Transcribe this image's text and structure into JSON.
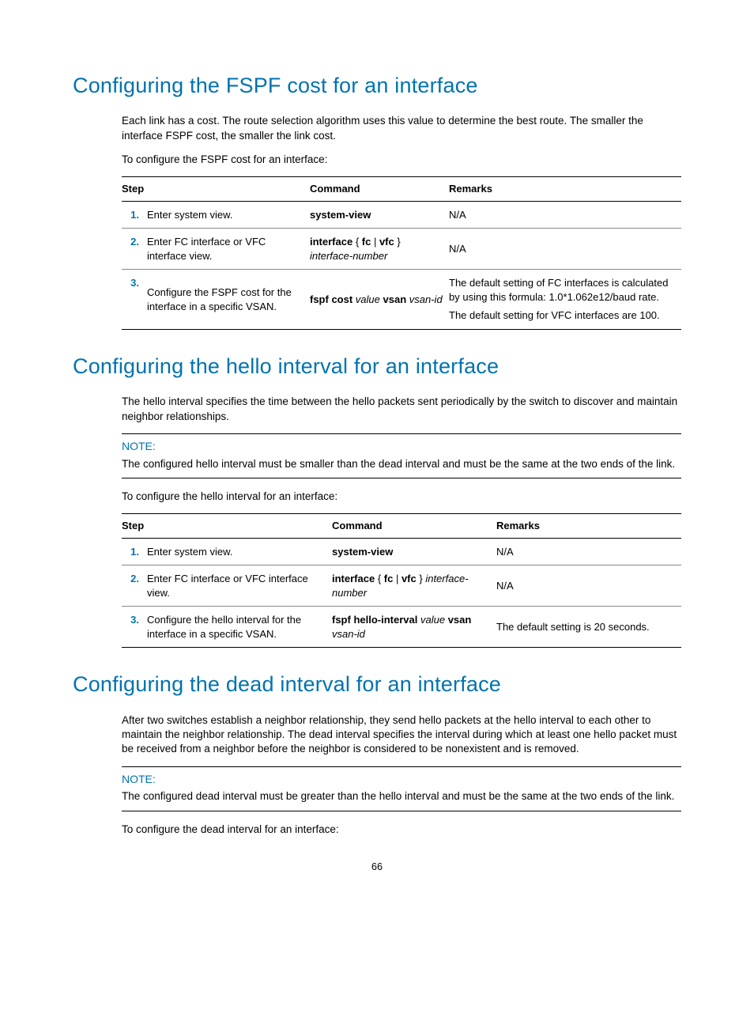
{
  "section1": {
    "heading": "Configuring the FSPF cost for an interface",
    "para1": "Each link has a cost. The route selection algorithm uses this value to determine the best route. The smaller the interface FSPF cost, the smaller the link cost.",
    "para2": "To configure the FSPF cost for an interface:",
    "table": {
      "headers": {
        "step": "Step",
        "command": "Command",
        "remarks": "Remarks"
      },
      "rows": [
        {
          "num": "1.",
          "step": "Enter system view.",
          "cmd_html": "<b>system-view</b>",
          "remarks_html": "N/A"
        },
        {
          "num": "2.",
          "step": "Enter FC interface or VFC interface view.",
          "cmd_html": "<b>interface</b> { <b>fc</b> | <b>vfc</b> } <i>interface-number</i>",
          "remarks_html": "N/A"
        },
        {
          "num": "3.",
          "step": "Configure the FSPF cost for the interface in a specific VSAN.",
          "cmd_html": "<b>fspf cost</b> <i>value</i> <b>vsan</b> <i>vsan-id</i>",
          "remarks_html": "<div style='margin-bottom:6px'>The default setting of FC interfaces is calculated by using this formula: 1.0*1.062e12/baud rate.</div><div>The default setting for VFC interfaces are 100.</div>"
        }
      ]
    }
  },
  "section2": {
    "heading": "Configuring the hello interval for an interface",
    "para1": "The hello interval specifies the time between the hello packets sent periodically by the switch to discover and maintain neighbor relationships.",
    "note_label": "NOTE:",
    "note_text": "The configured hello interval must be smaller than the dead interval and must be the same at the two ends of the link.",
    "para2": "To configure the hello interval for an interface:",
    "table": {
      "headers": {
        "step": "Step",
        "command": "Command",
        "remarks": "Remarks"
      },
      "rows": [
        {
          "num": "1.",
          "step": "Enter system view.",
          "cmd_html": "<b>system-view</b>",
          "remarks_html": "N/A"
        },
        {
          "num": "2.",
          "step": "Enter FC interface or VFC interface view.",
          "cmd_html": "<b>interface</b> { <b>fc</b> | <b>vfc</b> } <i>interface-number</i>",
          "remarks_html": "N/A"
        },
        {
          "num": "3.",
          "step": "Configure the hello interval for the interface in a specific VSAN.",
          "cmd_html": "<b>fspf hello-interval</b> <i>value</i> <b>vsan</b> <i>vsan-id</i>",
          "remarks_html": "The default setting is 20 seconds."
        }
      ]
    }
  },
  "section3": {
    "heading": "Configuring the dead interval for an interface",
    "para1": "After two switches establish a neighbor relationship, they send hello packets at the hello interval to each other to maintain the neighbor relationship. The dead interval specifies the interval during which at least one hello packet must be received from a neighbor before the neighbor is considered to be nonexistent and is removed.",
    "note_label": "NOTE:",
    "note_text": "The configured dead interval must be greater than the hello interval and must be the same at the two ends of the link.",
    "para2": "To configure the dead interval for an interface:"
  },
  "page_number": "66"
}
